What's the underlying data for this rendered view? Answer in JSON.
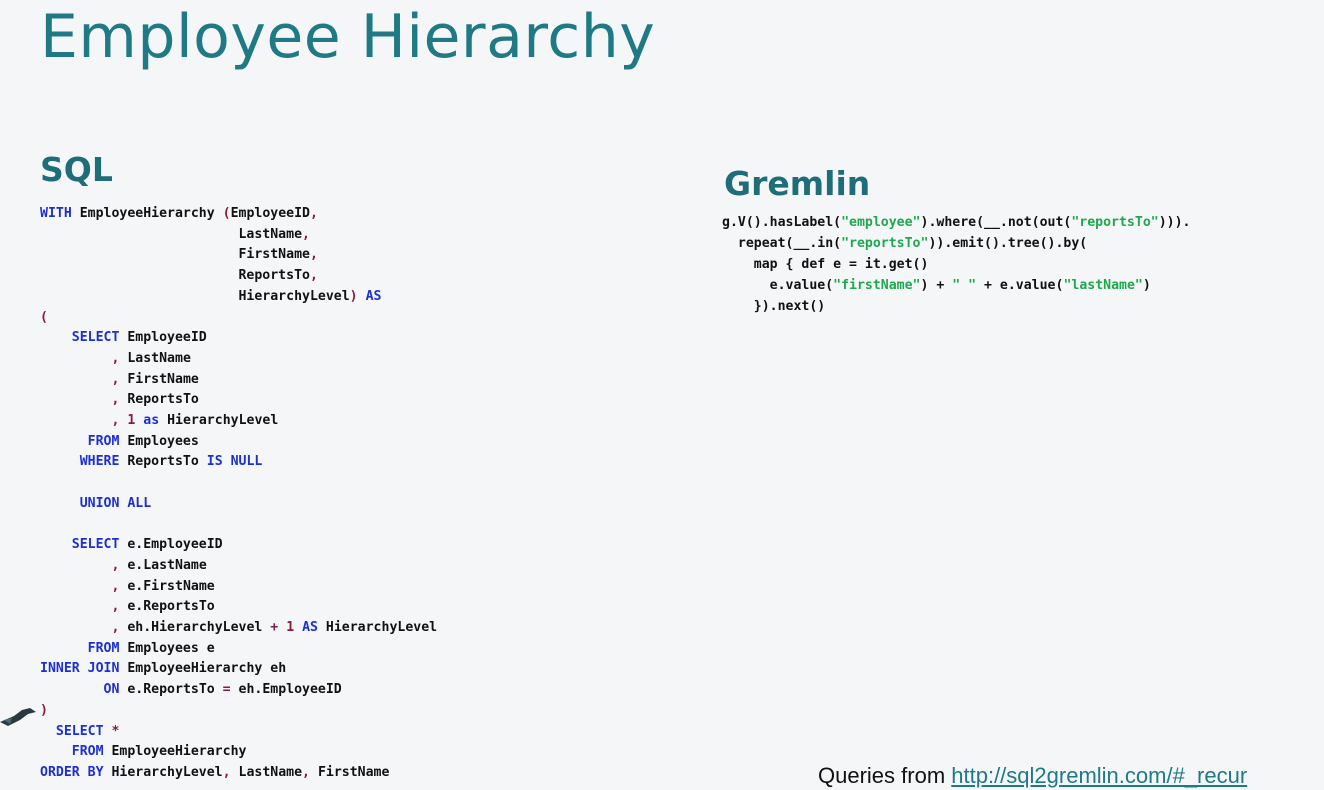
{
  "slide": {
    "title": "Employee Hierarchy",
    "sql_heading": "SQL",
    "gremlin_heading": "Gremlin",
    "footer_prefix": "Queries from ",
    "footer_link": "http://sql2gremlin.com/#_recur"
  },
  "sql_lines": [
    [
      [
        "kw",
        "WITH"
      ],
      [
        "t",
        " EmployeeHierarchy "
      ],
      [
        "op",
        "("
      ],
      [
        "t",
        "EmployeeID"
      ],
      [
        "op",
        ","
      ]
    ],
    [
      [
        "t",
        "                         LastName"
      ],
      [
        "op",
        ","
      ]
    ],
    [
      [
        "t",
        "                         FirstName"
      ],
      [
        "op",
        ","
      ]
    ],
    [
      [
        "t",
        "                         ReportsTo"
      ],
      [
        "op",
        ","
      ]
    ],
    [
      [
        "t",
        "                         HierarchyLevel"
      ],
      [
        "op",
        ")"
      ],
      [
        "t",
        " "
      ],
      [
        "kw",
        "AS"
      ]
    ],
    [
      [
        "op",
        "("
      ]
    ],
    [
      [
        "t",
        "    "
      ],
      [
        "kw",
        "SELECT"
      ],
      [
        "t",
        " EmployeeID"
      ]
    ],
    [
      [
        "t",
        "         "
      ],
      [
        "op",
        ","
      ],
      [
        "t",
        " LastName"
      ]
    ],
    [
      [
        "t",
        "         "
      ],
      [
        "op",
        ","
      ],
      [
        "t",
        " FirstName"
      ]
    ],
    [
      [
        "t",
        "         "
      ],
      [
        "op",
        ","
      ],
      [
        "t",
        " ReportsTo"
      ]
    ],
    [
      [
        "t",
        "         "
      ],
      [
        "op",
        ","
      ],
      [
        "t",
        " "
      ],
      [
        "num",
        "1"
      ],
      [
        "t",
        " "
      ],
      [
        "kw",
        "as"
      ],
      [
        "t",
        " HierarchyLevel"
      ]
    ],
    [
      [
        "t",
        "      "
      ],
      [
        "kw",
        "FROM"
      ],
      [
        "t",
        " Employees"
      ]
    ],
    [
      [
        "t",
        "     "
      ],
      [
        "kw",
        "WHERE"
      ],
      [
        "t",
        " ReportsTo "
      ],
      [
        "kw",
        "IS NULL"
      ]
    ],
    [
      [
        "t",
        ""
      ]
    ],
    [
      [
        "t",
        "     "
      ],
      [
        "kw",
        "UNION ALL"
      ]
    ],
    [
      [
        "t",
        ""
      ]
    ],
    [
      [
        "t",
        "    "
      ],
      [
        "kw",
        "SELECT"
      ],
      [
        "t",
        " e.EmployeeID"
      ]
    ],
    [
      [
        "t",
        "         "
      ],
      [
        "op",
        ","
      ],
      [
        "t",
        " e.LastName"
      ]
    ],
    [
      [
        "t",
        "         "
      ],
      [
        "op",
        ","
      ],
      [
        "t",
        " e.FirstName"
      ]
    ],
    [
      [
        "t",
        "         "
      ],
      [
        "op",
        ","
      ],
      [
        "t",
        " e.ReportsTo"
      ]
    ],
    [
      [
        "t",
        "         "
      ],
      [
        "op",
        ","
      ],
      [
        "t",
        " eh.HierarchyLevel "
      ],
      [
        "op",
        "+"
      ],
      [
        "t",
        " "
      ],
      [
        "num",
        "1"
      ],
      [
        "t",
        " "
      ],
      [
        "kw",
        "AS"
      ],
      [
        "t",
        " HierarchyLevel"
      ]
    ],
    [
      [
        "t",
        "      "
      ],
      [
        "kw",
        "FROM"
      ],
      [
        "t",
        " Employees e"
      ]
    ],
    [
      [
        "kw",
        "INNER JOIN"
      ],
      [
        "t",
        " EmployeeHierarchy eh"
      ]
    ],
    [
      [
        "t",
        "        "
      ],
      [
        "kw",
        "ON"
      ],
      [
        "t",
        " e.ReportsTo "
      ],
      [
        "op",
        "="
      ],
      [
        "t",
        " eh.EmployeeID"
      ]
    ],
    [
      [
        "op",
        ")"
      ]
    ],
    [
      [
        "t",
        "  "
      ],
      [
        "kw",
        "SELECT"
      ],
      [
        "t",
        " "
      ],
      [
        "op",
        "*"
      ]
    ],
    [
      [
        "t",
        "    "
      ],
      [
        "kw",
        "FROM"
      ],
      [
        "t",
        " EmployeeHierarchy"
      ]
    ],
    [
      [
        "kw",
        "ORDER BY"
      ],
      [
        "t",
        " HierarchyLevel"
      ],
      [
        "op",
        ","
      ],
      [
        "t",
        " LastName"
      ],
      [
        "op",
        ","
      ],
      [
        "t",
        " FirstName"
      ]
    ]
  ],
  "gremlin_lines": [
    [
      [
        "t",
        "g.V().hasLabel("
      ],
      [
        "str",
        "\"employee\""
      ],
      [
        "t",
        ").where(__.not(out("
      ],
      [
        "str",
        "\"reportsTo\""
      ],
      [
        "t",
        ")))."
      ]
    ],
    [
      [
        "t",
        "  repeat(__.in("
      ],
      [
        "str",
        "\"reportsTo\""
      ],
      [
        "t",
        ")).emit().tree().by("
      ]
    ],
    [
      [
        "t",
        "    map { def e = it.get()"
      ]
    ],
    [
      [
        "t",
        "      e.value("
      ],
      [
        "str",
        "\"firstName\""
      ],
      [
        "t",
        ") + "
      ],
      [
        "str",
        "\" \""
      ],
      [
        "t",
        " + e.value("
      ],
      [
        "str",
        "\"lastName\""
      ],
      [
        "t",
        ")"
      ]
    ],
    [
      [
        "t",
        "    }).next()"
      ]
    ]
  ]
}
